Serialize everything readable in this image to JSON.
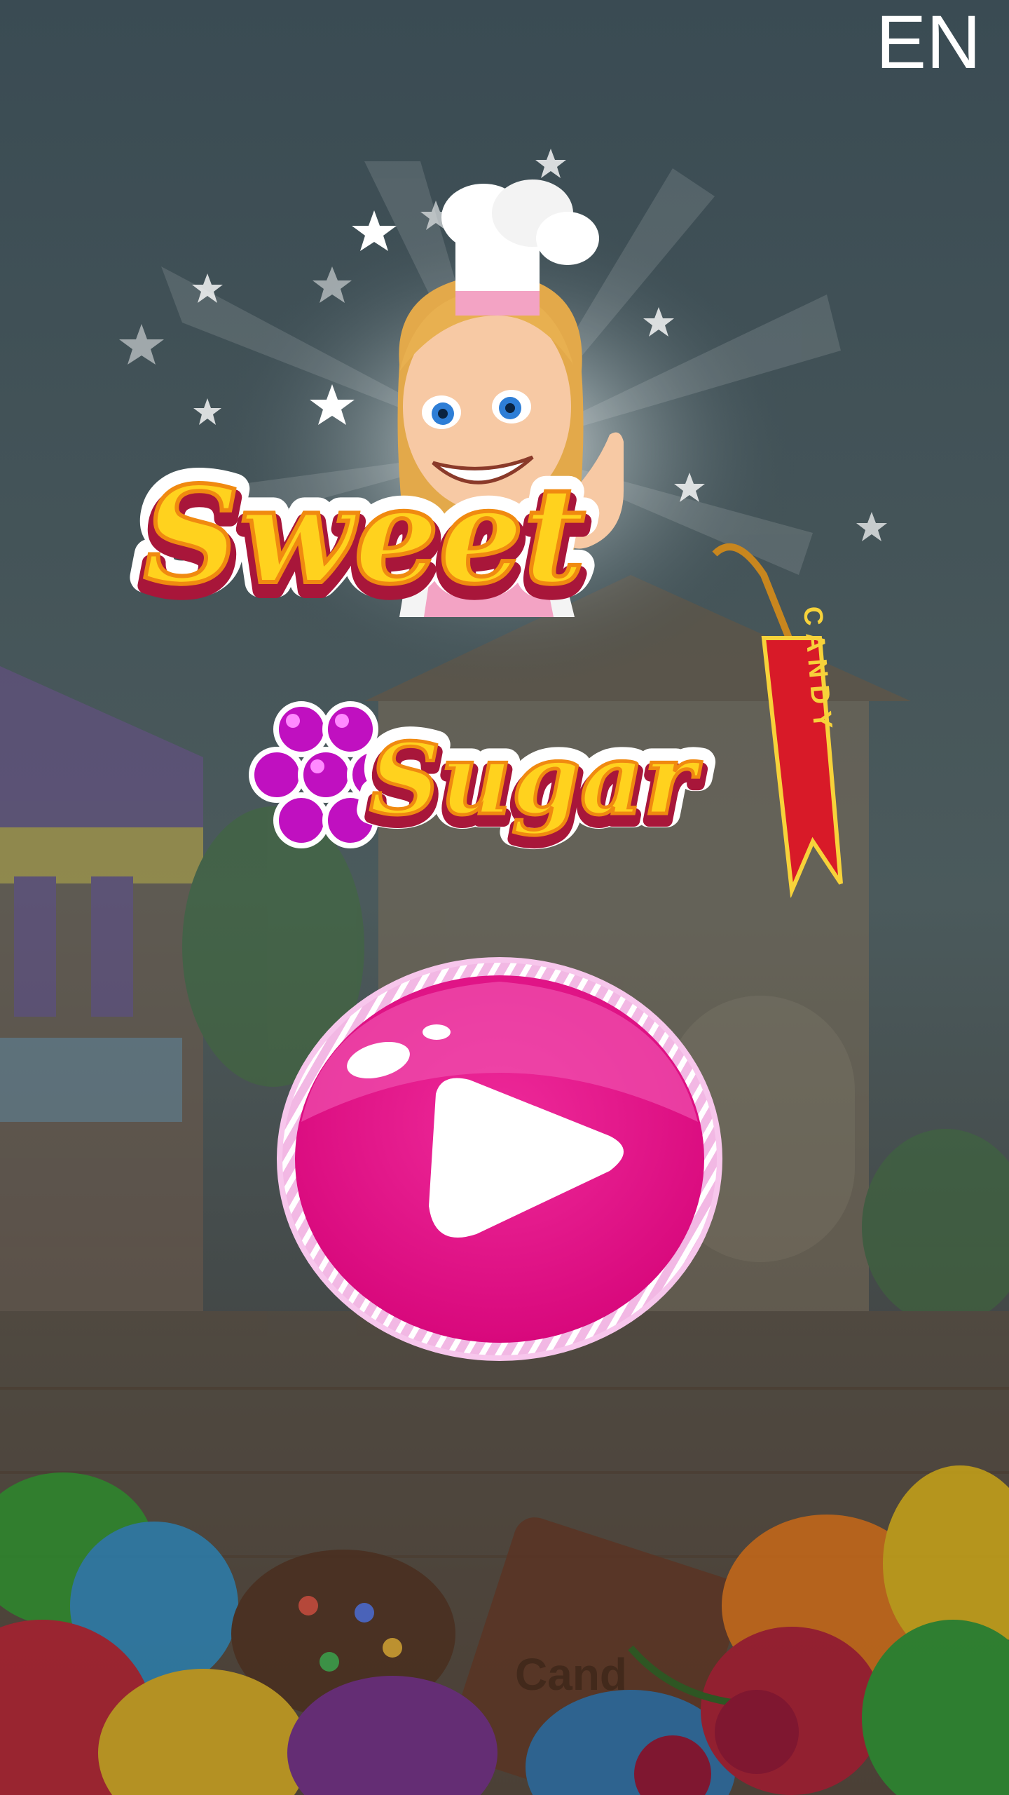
{
  "lang_button": {
    "label": "EN"
  },
  "logo": {
    "title_line1": "Sweet",
    "title_line2": "Sugar",
    "ribbon_text": "CANDY"
  },
  "background_hint": "Cand",
  "colors": {
    "accent_pink": "#e8198a",
    "title_yellow": "#ffd21e",
    "title_outline": "#a8163a",
    "ribbon_red": "#d81a28"
  }
}
